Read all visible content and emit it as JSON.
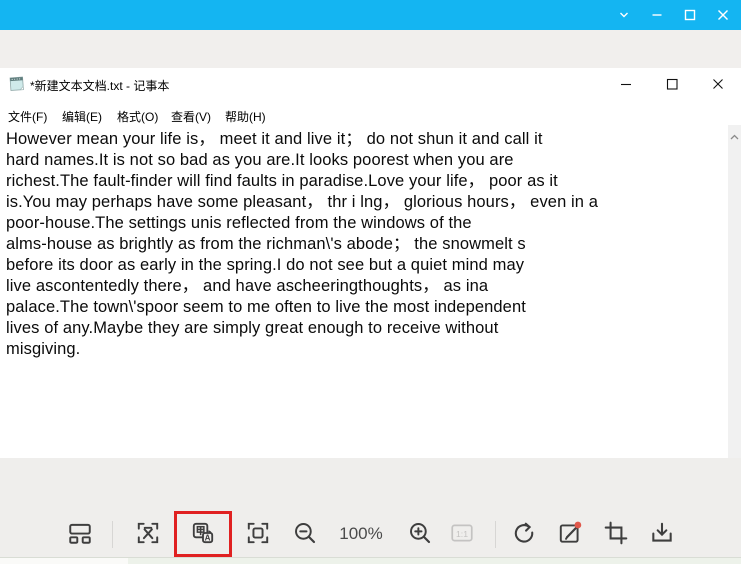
{
  "viewer": {
    "titlebar": {
      "bg_color": "#14b5f2",
      "icons": [
        "chevron-down",
        "minimize",
        "maximize",
        "close"
      ]
    },
    "toolbar": {
      "zoom_level": "100%",
      "highlight_color": "#e02121",
      "buttons": [
        {
          "icon": "layout-icon"
        },
        {
          "icon": "ocr-icon"
        },
        {
          "icon": "translate-icon",
          "highlighted": true
        },
        {
          "icon": "fit-screen-icon"
        },
        {
          "icon": "zoom-out-icon"
        },
        {
          "icon": "zoom-in-icon"
        },
        {
          "icon": "one-to-one-icon",
          "disabled": true
        },
        {
          "icon": "rotate-icon"
        },
        {
          "icon": "edit-icon",
          "badge": true
        },
        {
          "icon": "crop-icon"
        },
        {
          "icon": "download-icon"
        }
      ]
    }
  },
  "notepad": {
    "title": "*新建文本文档.txt - 记事本",
    "menu": {
      "items": [
        {
          "label": "文件(F)"
        },
        {
          "label": "编辑(E)"
        },
        {
          "label": "格式(O)"
        },
        {
          "label": "查看(V)"
        },
        {
          "label": "帮助(H)"
        }
      ]
    },
    "content_lines": [
      "However mean your life is， meet it and live it； do not shun it and call it",
      "hard names.It is not so bad as you are.It looks poorest when you are",
      "richest.The fault-finder will find faults in paradise.Love your life， poor as it",
      "is.You may perhaps have some pleasant， thr i lng， glorious hours， even in a",
      "poor-house.The settings unis reflected from the windows of the",
      "alms-house as brightly as from the richman\\'s abode； the snowmelt s",
      "before its door as early in the spring.I do not see but a quiet mind may",
      "live ascontentedly there， and have ascheeringthoughts， as ina",
      "palace.The town\\'spoor seem to me often to live the most independent",
      "lives of any.Maybe they are simply great enough to receive without",
      "misgiving."
    ]
  }
}
